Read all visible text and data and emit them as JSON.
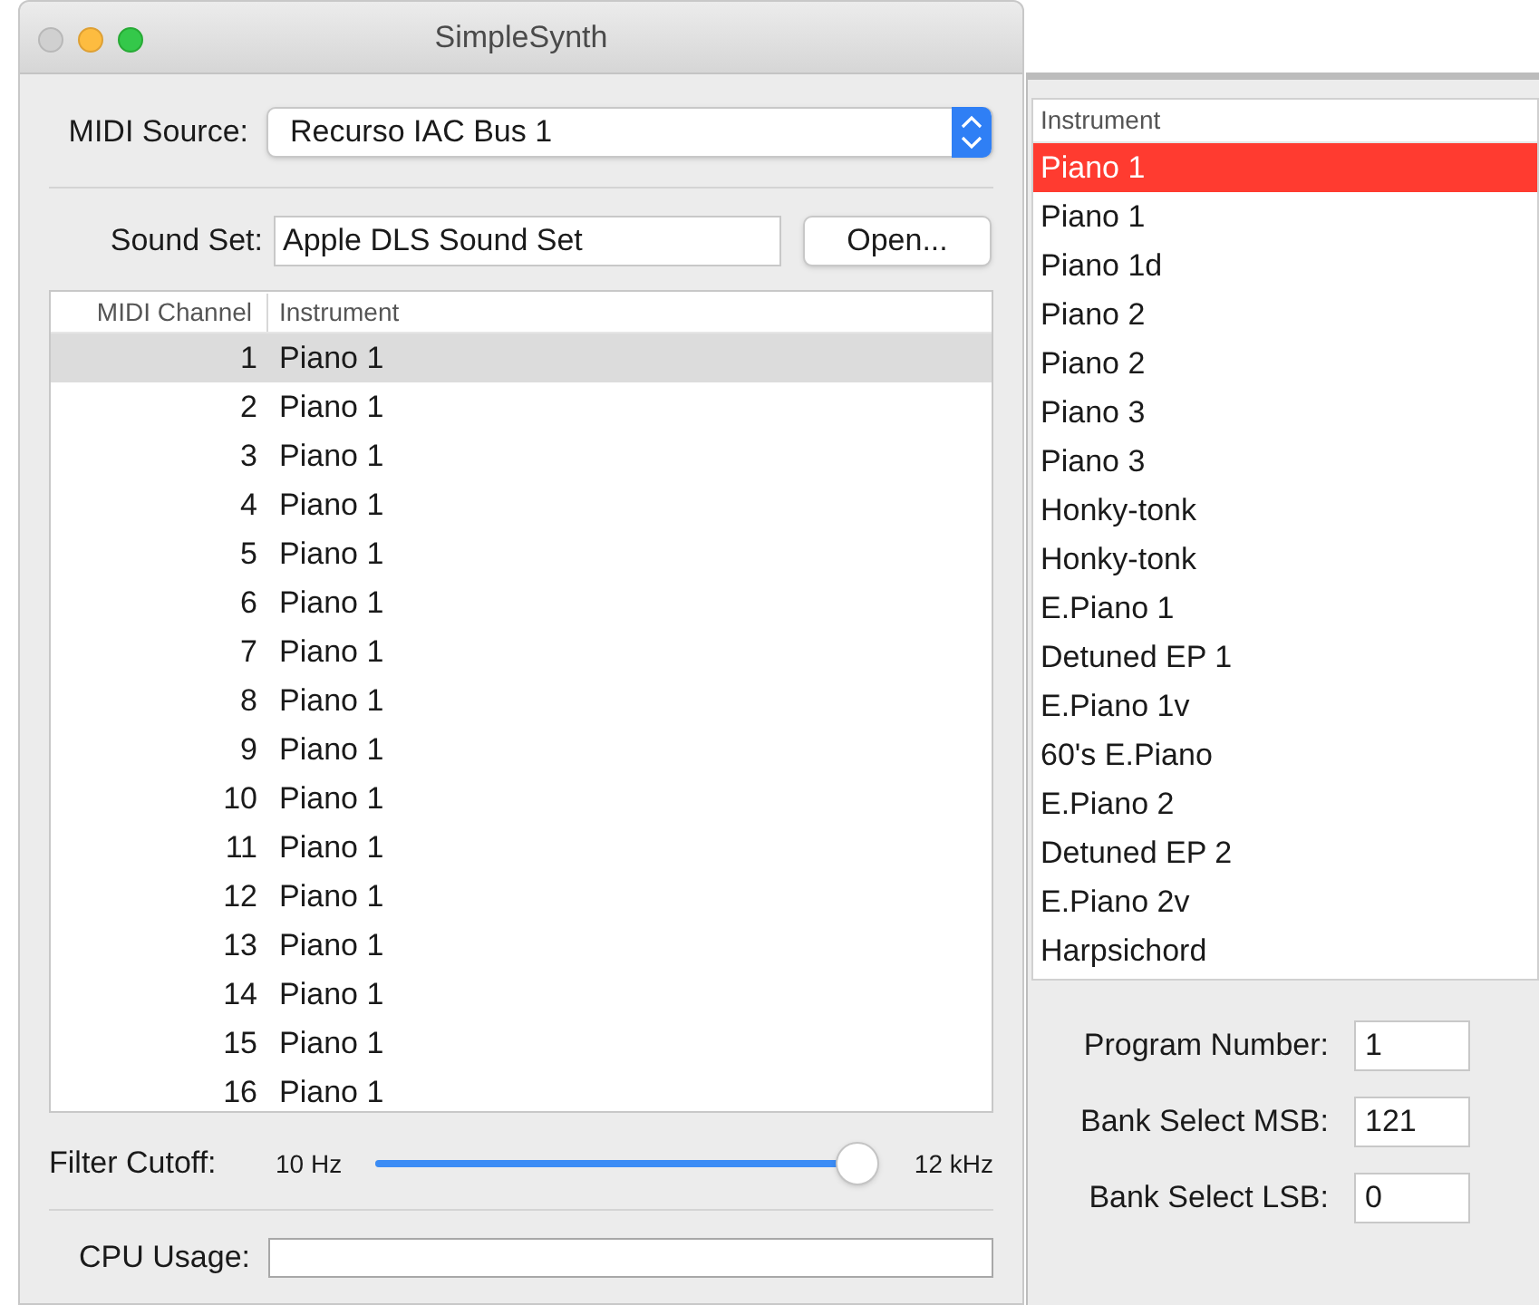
{
  "window": {
    "title": "SimpleSynth"
  },
  "midi_source": {
    "label": "MIDI Source:",
    "value": "Recurso IAC Bus 1"
  },
  "sound_set": {
    "label": "Sound Set:",
    "value": "Apple DLS Sound Set",
    "button": "Open..."
  },
  "channel_table": {
    "columns": [
      "MIDI Channel",
      "Instrument"
    ],
    "rows": [
      {
        "channel": "1",
        "instrument": "Piano 1",
        "selected": true
      },
      {
        "channel": "2",
        "instrument": "Piano 1",
        "selected": false
      },
      {
        "channel": "3",
        "instrument": "Piano 1",
        "selected": false
      },
      {
        "channel": "4",
        "instrument": "Piano 1",
        "selected": false
      },
      {
        "channel": "5",
        "instrument": "Piano 1",
        "selected": false
      },
      {
        "channel": "6",
        "instrument": "Piano 1",
        "selected": false
      },
      {
        "channel": "7",
        "instrument": "Piano 1",
        "selected": false
      },
      {
        "channel": "8",
        "instrument": "Piano 1",
        "selected": false
      },
      {
        "channel": "9",
        "instrument": "Piano 1",
        "selected": false
      },
      {
        "channel": "10",
        "instrument": "Piano 1",
        "selected": false
      },
      {
        "channel": "11",
        "instrument": "Piano 1",
        "selected": false
      },
      {
        "channel": "12",
        "instrument": "Piano 1",
        "selected": false
      },
      {
        "channel": "13",
        "instrument": "Piano 1",
        "selected": false
      },
      {
        "channel": "14",
        "instrument": "Piano 1",
        "selected": false
      },
      {
        "channel": "15",
        "instrument": "Piano 1",
        "selected": false
      },
      {
        "channel": "16",
        "instrument": "Piano 1",
        "selected": false
      }
    ]
  },
  "filter_cutoff": {
    "label": "Filter Cutoff:",
    "min_label": "10 Hz",
    "max_label": "12 kHz",
    "level": 1.0
  },
  "cpu_usage": {
    "label": "CPU Usage:"
  },
  "instrument_panel": {
    "column": "Instrument",
    "items": [
      {
        "name": "Piano 1",
        "selected": true
      },
      {
        "name": "Piano 1",
        "selected": false
      },
      {
        "name": "Piano 1d",
        "selected": false
      },
      {
        "name": "Piano 2",
        "selected": false
      },
      {
        "name": "Piano 2",
        "selected": false
      },
      {
        "name": "Piano 3",
        "selected": false
      },
      {
        "name": "Piano 3",
        "selected": false
      },
      {
        "name": "Honky-tonk",
        "selected": false
      },
      {
        "name": "Honky-tonk",
        "selected": false
      },
      {
        "name": "E.Piano 1",
        "selected": false
      },
      {
        "name": "Detuned EP 1",
        "selected": false
      },
      {
        "name": "E.Piano 1v",
        "selected": false
      },
      {
        "name": "60's E.Piano",
        "selected": false
      },
      {
        "name": "E.Piano 2",
        "selected": false
      },
      {
        "name": "Detuned EP 2",
        "selected": false
      },
      {
        "name": "E.Piano 2v",
        "selected": false
      },
      {
        "name": "Harpsichord",
        "selected": false
      }
    ],
    "fields": [
      {
        "label": "Program Number:",
        "value": "1"
      },
      {
        "label": "Bank Select MSB:",
        "value": "121"
      },
      {
        "label": "Bank Select LSB:",
        "value": "0"
      }
    ]
  }
}
